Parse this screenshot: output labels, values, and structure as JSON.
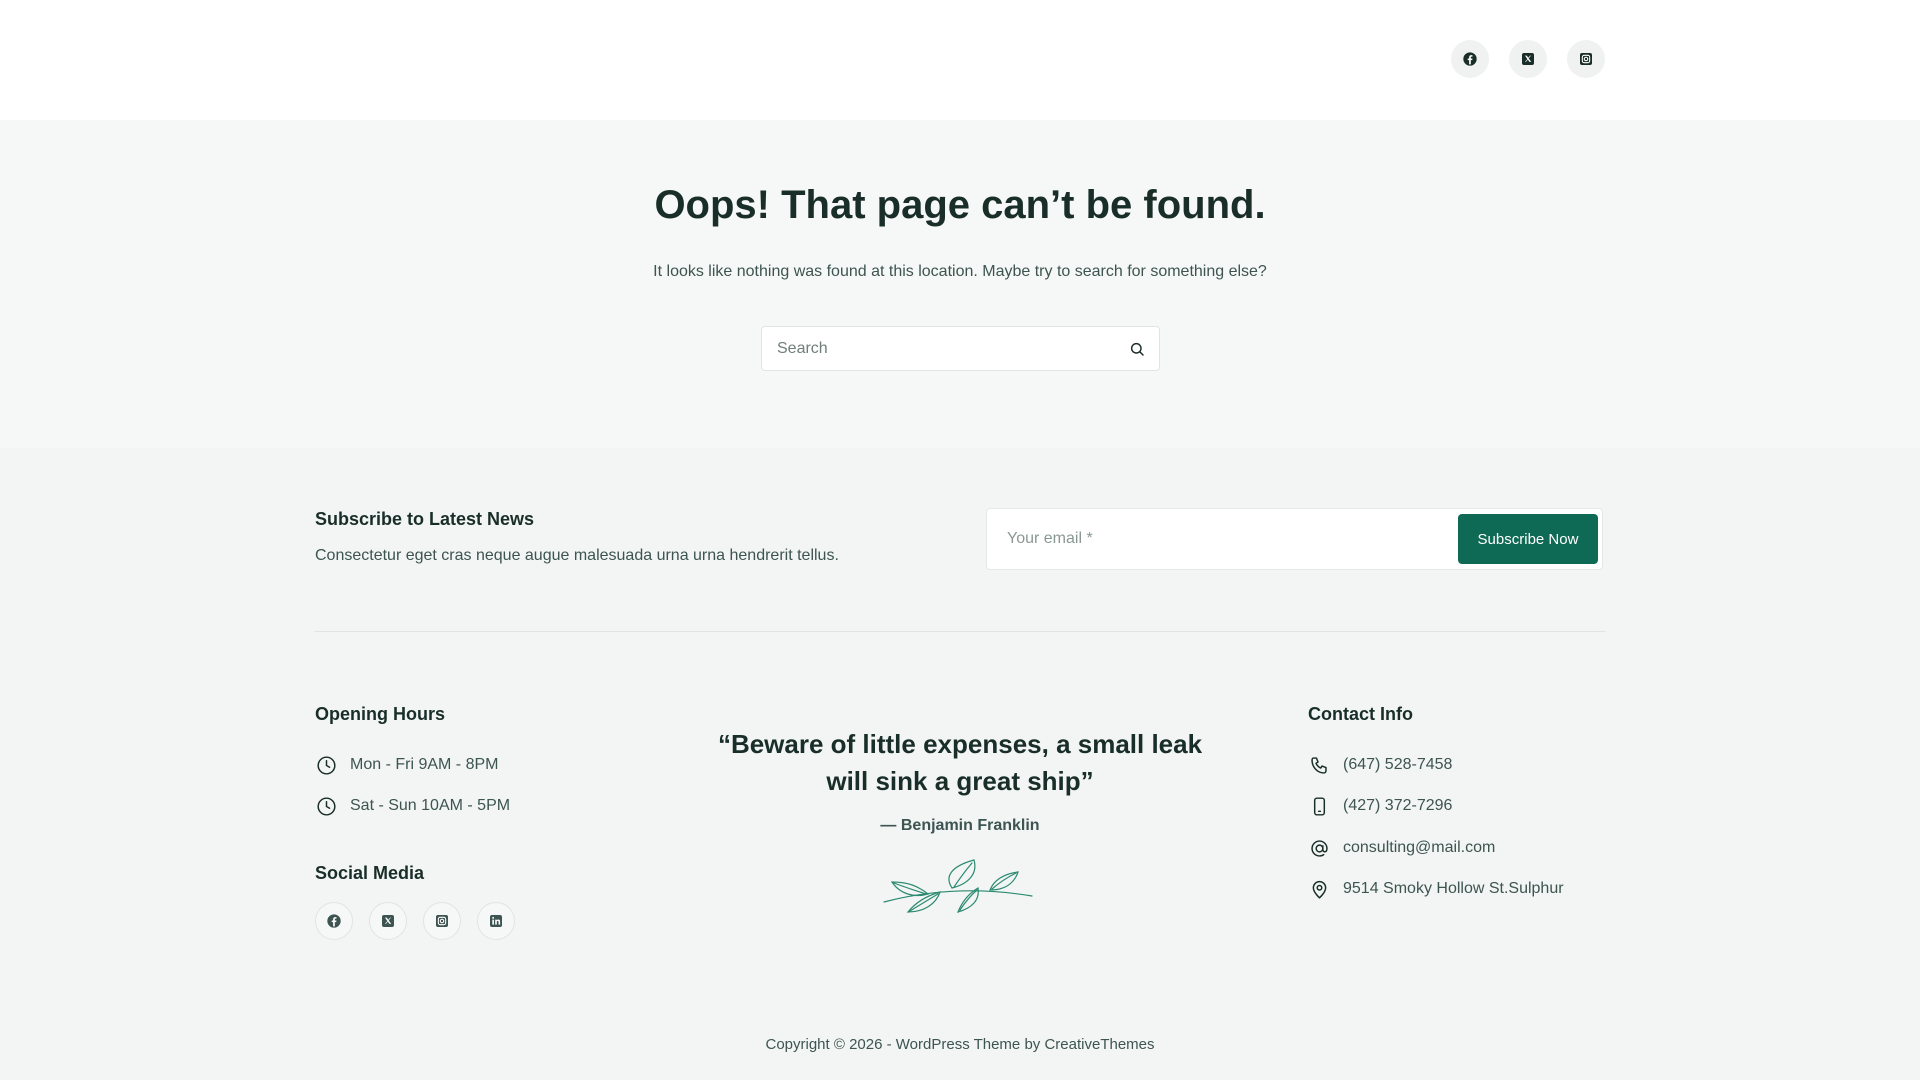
{
  "header": {
    "social_icons": [
      "facebook-icon",
      "x-twitter-icon",
      "instagram-icon"
    ]
  },
  "hero": {
    "title": "Oops! That page can’t be found.",
    "message": "It looks like nothing was found at this location. Maybe try to search for something else?",
    "search": {
      "placeholder": "Search",
      "value": ""
    }
  },
  "subscribe": {
    "title": "Subscribe to Latest News",
    "description": "Consectetur eget cras neque augue malesuada urna urna hendrerit tellus.",
    "email_placeholder": "Your email *",
    "button_label": "Subscribe Now"
  },
  "opening_hours": {
    "title": "Opening Hours",
    "rows": [
      {
        "icon": "clock-icon",
        "text": "Mon - Fri 9AM - 8PM"
      },
      {
        "icon": "clock-icon",
        "text": "Sat - Sun 10AM - 5PM"
      }
    ]
  },
  "social_media": {
    "title": "Social Media",
    "icons": [
      "facebook-icon",
      "x-twitter-icon",
      "instagram-icon",
      "linkedin-icon"
    ]
  },
  "quote": {
    "text": "“Beware of little expenses, a small leak will sink a great ship”",
    "author": "— Benjamin Franklin"
  },
  "contact": {
    "title": "Contact Info",
    "rows": [
      {
        "icon": "phone-icon",
        "text": "(647) 528-7458"
      },
      {
        "icon": "mobile-icon",
        "text": "(427) 372-7296"
      },
      {
        "icon": "at-icon",
        "text": "consulting@mail.com"
      },
      {
        "icon": "location-pin-icon",
        "text": "9514 Smoky Hollow St.Sulphur"
      }
    ]
  },
  "footer": {
    "copyright_prefix": "Copyright © 2026 - ",
    "theme_link": "WordPress Theme",
    "by_text": " by ",
    "author_link": "CreativeThemes"
  },
  "colors": {
    "accent": "#0e6a54",
    "heading": "#1a2e29",
    "text": "#3d5450",
    "background": "#f2f5f4"
  }
}
